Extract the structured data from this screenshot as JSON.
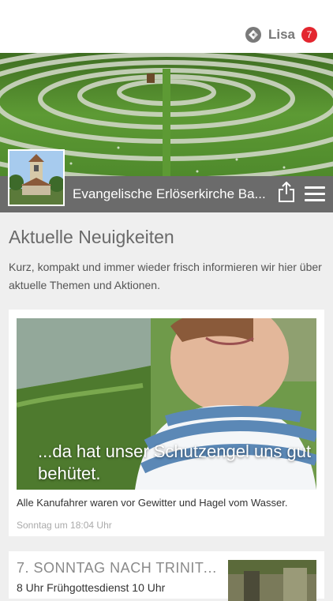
{
  "header": {
    "username": "Lisa",
    "badge_count": "7"
  },
  "church": {
    "name": "Evangelische Erlöserkirche Ba..."
  },
  "news": {
    "title": "Aktuelle Neuigkeiten",
    "description": "Kurz, kompakt und immer wieder frisch informieren wir hier über aktuelle Themen und Aktionen."
  },
  "posts": [
    {
      "overlay_text": "...da hat unser Schutzengel uns gut behütet.",
      "caption": "Alle Kanufahrer waren vor Gewitter und Hagel vom Wasser.",
      "time": "Sonntag um 18:04 Uhr"
    },
    {
      "title": "7. SONNTAG NACH TRINITA...",
      "subtitle": "8 Uhr Frühgottesdienst 10 Uhr"
    }
  ],
  "icons": {
    "logo": "app-logo-icon",
    "share": "share-icon",
    "menu": "hamburger-menu-icon"
  },
  "colors": {
    "badge": "#e3262f",
    "church_bar": "#6b6b6b"
  }
}
